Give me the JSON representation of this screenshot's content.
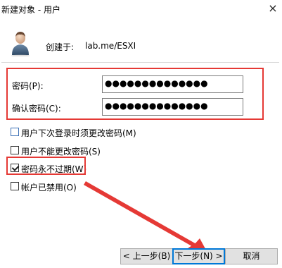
{
  "window": {
    "title": "新建对象 - 用户",
    "close_glyph": "×"
  },
  "header": {
    "created_label": "创建于:",
    "created_value": "lab.me/ESXI"
  },
  "form": {
    "password_label": "密码(P):",
    "password_value": "●●●●●●●●●●●●●●",
    "confirm_label": "确认密码(C):",
    "confirm_value": "●●●●●●●●●●●●●●"
  },
  "options": [
    {
      "label": "用户下次登录时须更改密码(M)",
      "checked": false
    },
    {
      "label": "用户不能更改密码(S)",
      "checked": false
    },
    {
      "label": "密码永不过期(W)",
      "checked": true
    },
    {
      "label": "帐户已禁用(O)",
      "checked": false
    }
  ],
  "buttons": {
    "back_label": "< 上一步(B)",
    "next_label": "下一步(N) >",
    "cancel_label": "取消"
  },
  "colors": {
    "annotation_red": "#e53935",
    "focus_blue": "#0078d7"
  }
}
